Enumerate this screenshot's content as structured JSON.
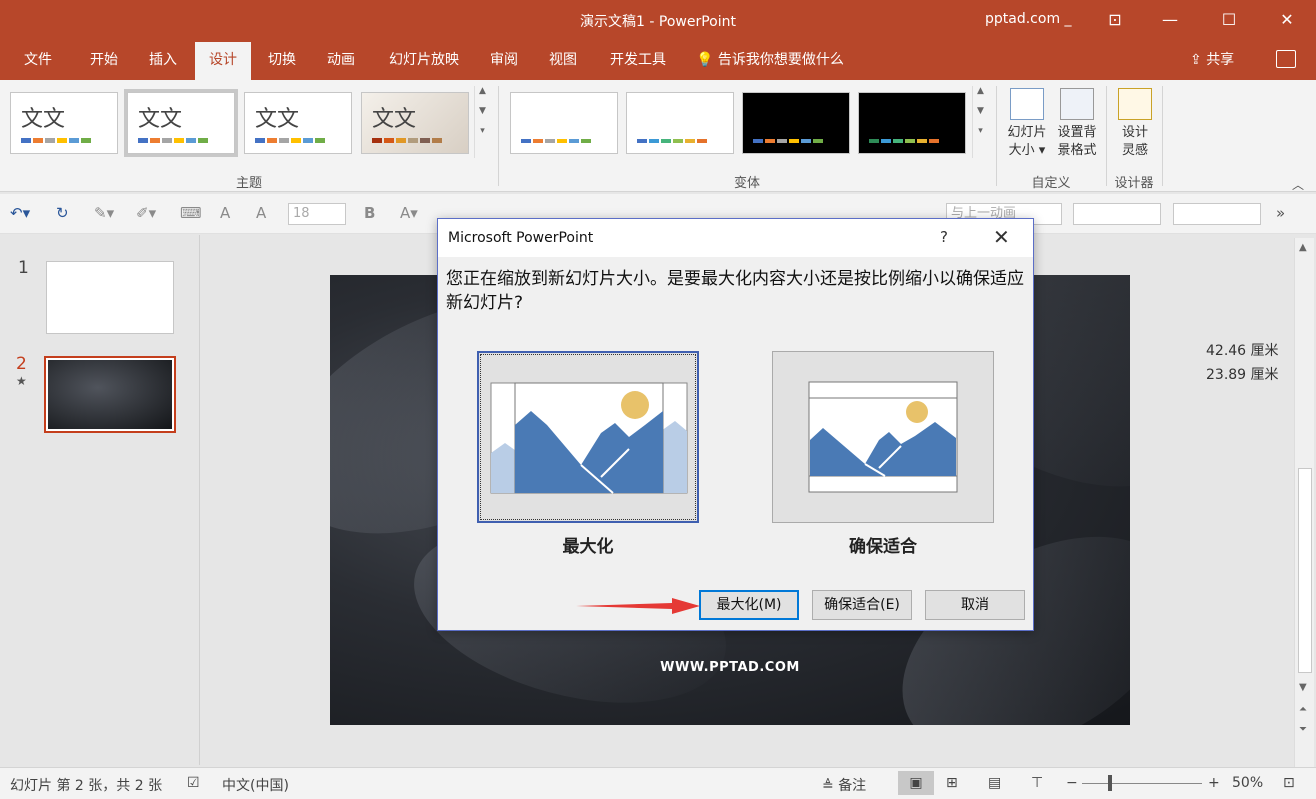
{
  "window": {
    "title": "演示文稿1  -  PowerPoint",
    "account": "pptad.com _"
  },
  "menu": {
    "tabs": [
      "文件",
      "开始",
      "插入",
      "设计",
      "切换",
      "动画",
      "幻灯片放映",
      "审阅",
      "视图",
      "开发工具"
    ],
    "active": "设计",
    "tell_me": "告诉我你想要做什么",
    "share": "共享"
  },
  "ribbon": {
    "themes_label": "主题",
    "variants_label": "变体",
    "customize_label": "自定义",
    "designer_label": "设计器",
    "theme_text": "文文",
    "slide_size_line1": "幻灯片",
    "slide_size_line2": "大小",
    "format_bg_line1": "设置背",
    "format_bg_line2": "景格式",
    "design_ideas_line1": "设计",
    "design_ideas_line2": "灵感"
  },
  "toolbar": {
    "font_size": "18",
    "bold": "B",
    "animation_box": "与上一动画"
  },
  "slides": {
    "numbers": [
      "1",
      "2"
    ],
    "current": "2",
    "star": "★"
  },
  "slide": {
    "url_text": "WWW.PPTAD.COM"
  },
  "size_info": {
    "width": "42.46 厘米",
    "height": "23.89 厘米"
  },
  "dialog": {
    "title": "Microsoft PowerPoint",
    "help": "?",
    "close": "✕",
    "message": "您正在缩放到新幻灯片大小。是要最大化内容大小还是按比例缩小以确保适应新幻灯片?",
    "option_maximize": "最大化",
    "option_ensure_fit": "确保适合",
    "btn_maximize": "最大化(M)",
    "btn_ensure_fit": "确保适合(E)",
    "btn_cancel": "取消"
  },
  "status": {
    "slide_info": "幻灯片 第 2 张，共 2 张",
    "language": "中文(中国)",
    "notes": "备注",
    "zoom": "50%"
  },
  "colors": {
    "accent": "#b7472a",
    "selected_slide": "#c43e1c",
    "dialog_border": "#5b6ec7",
    "arrow": "#e53935"
  }
}
